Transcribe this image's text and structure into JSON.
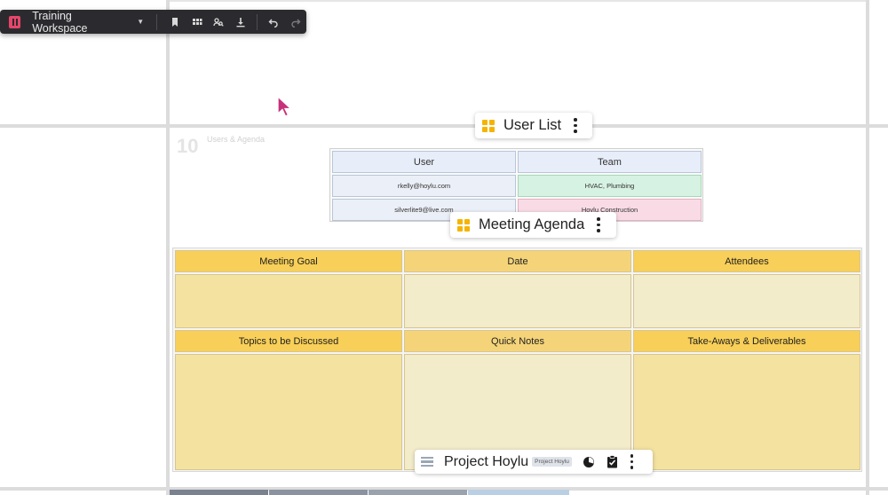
{
  "toolbar": {
    "title": "Training Workspace",
    "icons": [
      "hoylu-logo-icon",
      "caret-down-icon",
      "bookmark-icon",
      "grid-view-icon",
      "people-search-icon",
      "download-icon",
      "undo-icon",
      "redo-icon"
    ]
  },
  "panel": {
    "number": "10",
    "name": "Users & Agenda"
  },
  "user_list": {
    "title": "User List",
    "columns": [
      "User",
      "Team"
    ],
    "rows": [
      {
        "user": "rkelly@hoylu.com",
        "team": "HVAC, Plumbing"
      },
      {
        "user": "silverlite9@live.com",
        "team": "Hoylu Construction"
      }
    ]
  },
  "agenda": {
    "title": "Meeting Agenda",
    "row1": [
      "Meeting Goal",
      "Date",
      "Attendees"
    ],
    "row2": [
      "Topics to be Discussed",
      "Quick Notes",
      "Take-Aways & Deliverables"
    ]
  },
  "project": {
    "title": "Project Hoylu",
    "tag": "Project Hoylu"
  },
  "colors": {
    "accent": "#f5b400",
    "toolbar_bg": "#2b2b2f",
    "logo": "#e8456a",
    "cursor": "#c8307a"
  }
}
